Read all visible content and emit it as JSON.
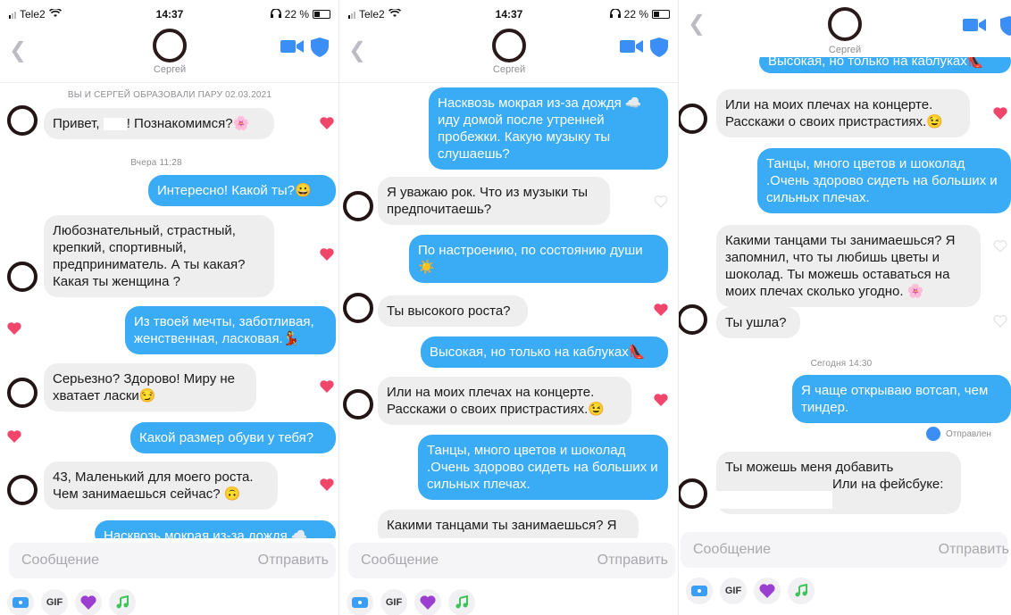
{
  "status": {
    "carrier": "Tele2",
    "time": "14:37",
    "battery1": "22 %",
    "battery2": "22 %"
  },
  "contact": {
    "name": "Сергей"
  },
  "icons": {
    "back": "chevron-left-icon",
    "video": "video-camera-icon",
    "shield": "shield-icon",
    "heart": "heart-icon"
  },
  "colors": {
    "outgoing": "#3aabf5",
    "incoming": "#eeeeef",
    "heart": "#f0466b",
    "accent": "#3a8ef5"
  },
  "panel1": {
    "match_line": "ВЫ И СЕРГЕЙ ОБРАЗОВАЛИ ПАРУ 02.03.2021",
    "yesterday": "Вчера 11:28",
    "messages": [
      {
        "from": "in",
        "text_before": "Привет, ",
        "text_after": "! Познакомимся?🌸"
      },
      {
        "from": "out",
        "text": "Интересно! Какой ты?😀"
      },
      {
        "from": "in",
        "text": "Любознательный, страстный, крепкий, спортивный, предприниматель. А ты какая? Какая ты женщина ?"
      },
      {
        "from": "out",
        "text": "Из твоей мечты, заботливая, женственная, ласковая.💃"
      },
      {
        "from": "in",
        "text": "Серьезно? Здорово! Миру не хватает ласки😏"
      },
      {
        "from": "out",
        "text": "Какой размер обуви у тебя?"
      },
      {
        "from": "in",
        "text": "43, Маленький для моего роста. Чем занимаешься сейчас? 🙃"
      },
      {
        "from": "out",
        "text": "Насквозь мокрая из-за дождя ☁️"
      }
    ]
  },
  "panel2": {
    "messages": [
      {
        "from": "out",
        "text": "Насквозь мокрая из-за дождя ☁️ иду домой после утренней пробежки. Какую музыку ты слушаешь?"
      },
      {
        "from": "in",
        "text": "Я уважаю рок. Что из музыки ты предпочитаешь?"
      },
      {
        "from": "out",
        "text": "По настроению, по состоянию души ☀️"
      },
      {
        "from": "in",
        "text": "Ты высокого роста?"
      },
      {
        "from": "out",
        "text": "Высокая, но только на каблуках👠"
      },
      {
        "from": "in",
        "text": "Или на моих плечах на концерте. Расскажи о своих пристрастиях.😉"
      },
      {
        "from": "out",
        "text": "Танцы, много цветов и шоколад .Очень здорово сидеть на больших и сильных плечах."
      },
      {
        "from": "in",
        "text": "Какими танцами ты занимаешься? Я"
      }
    ]
  },
  "panel3": {
    "today": "Сегодня 14:30",
    "sent_status": "Отправлен",
    "messages": [
      {
        "from": "out",
        "text": "Высокая, но только на каблуках👠"
      },
      {
        "from": "in",
        "text": "Или на моих плечах на концерте. Расскажи о своих пристрастиях.😉"
      },
      {
        "from": "out",
        "text": "Танцы, много цветов и шоколад .Очень здорово сидеть на больших и сильных плечах."
      },
      {
        "from": "in",
        "text": "Какими танцами ты занимаешься? Я запомнил, что ты любишь цветы и шоколад. Ты можешь оставаться на моих плечах сколько угодно. 🌸"
      },
      {
        "from": "in",
        "text": "Ты ушла?"
      },
      {
        "from": "out",
        "text": "Я чаще открываю вотсап, чем тиндер."
      },
      {
        "from": "in",
        "text_before": "Ты можешь меня добавить",
        "text_after": "Или на фейсбуке:"
      }
    ]
  },
  "composer": {
    "placeholder": "Сообщение",
    "send": "Отправить",
    "gif": "GIF"
  }
}
